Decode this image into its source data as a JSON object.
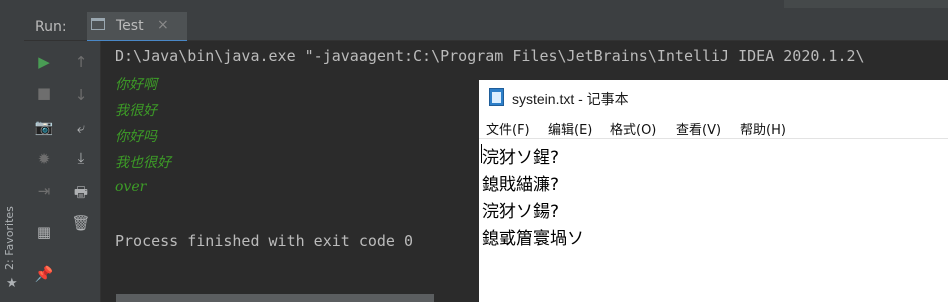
{
  "favorites": {
    "label": "2: Favorites",
    "star_icon": "star-icon"
  },
  "run_panel": {
    "run_label": "Run:",
    "tab": {
      "name": "Test",
      "close": "×"
    },
    "toolbar_col1": [
      {
        "name": "rerun-icon",
        "glyph": "▶",
        "color": "#499c54"
      },
      {
        "name": "stop-icon",
        "glyph": "■",
        "color": "#6e6e6e"
      },
      {
        "name": "camera-icon",
        "glyph": "📷",
        "color": "#6e6e6e"
      },
      {
        "name": "debug-icon",
        "glyph": "✹",
        "color": "#6e6e6e"
      },
      {
        "name": "exit-icon",
        "glyph": "⇥",
        "color": "#6e6e6e"
      },
      {
        "name": "layout-icon",
        "glyph": "▦",
        "color": "#afb1b3"
      },
      {
        "name": "pin-icon",
        "glyph": "📌",
        "color": "#afb1b3"
      }
    ],
    "toolbar_col2": [
      {
        "name": "up-arrow-icon",
        "glyph": "↑",
        "color": "#6e6e6e"
      },
      {
        "name": "down-arrow-icon",
        "glyph": "↓",
        "color": "#6e6e6e"
      },
      {
        "name": "soft-wrap-icon",
        "glyph": "⤶",
        "color": "#afb1b3"
      },
      {
        "name": "scroll-to-end-icon",
        "glyph": "⤓",
        "color": "#afb1b3"
      },
      {
        "name": "print-icon",
        "glyph": "🖶",
        "color": "#afb1b3"
      },
      {
        "name": "trash-icon",
        "glyph": "🗑",
        "color": "#afb1b3"
      }
    ]
  },
  "console": {
    "command": "D:\\Java\\bin\\java.exe \"-javaagent:C:\\Program Files\\JetBrains\\IntelliJ IDEA 2020.1.2\\",
    "output": [
      "你好啊",
      "我很好",
      "你好吗",
      "我也很好",
      "over"
    ],
    "exit_message": "Process finished with exit code 0"
  },
  "notepad": {
    "title": "systein.txt - 记事本",
    "menus": [
      "文件(F)",
      "编辑(E)",
      "格式(O)",
      "查看(V)",
      "帮助(H)"
    ],
    "lines": [
      "浣犲ソ鍟?",
      "鎴戝緢濂?",
      "浣犲ソ鍚?",
      "鎴戜篃寰堝ソ"
    ]
  }
}
